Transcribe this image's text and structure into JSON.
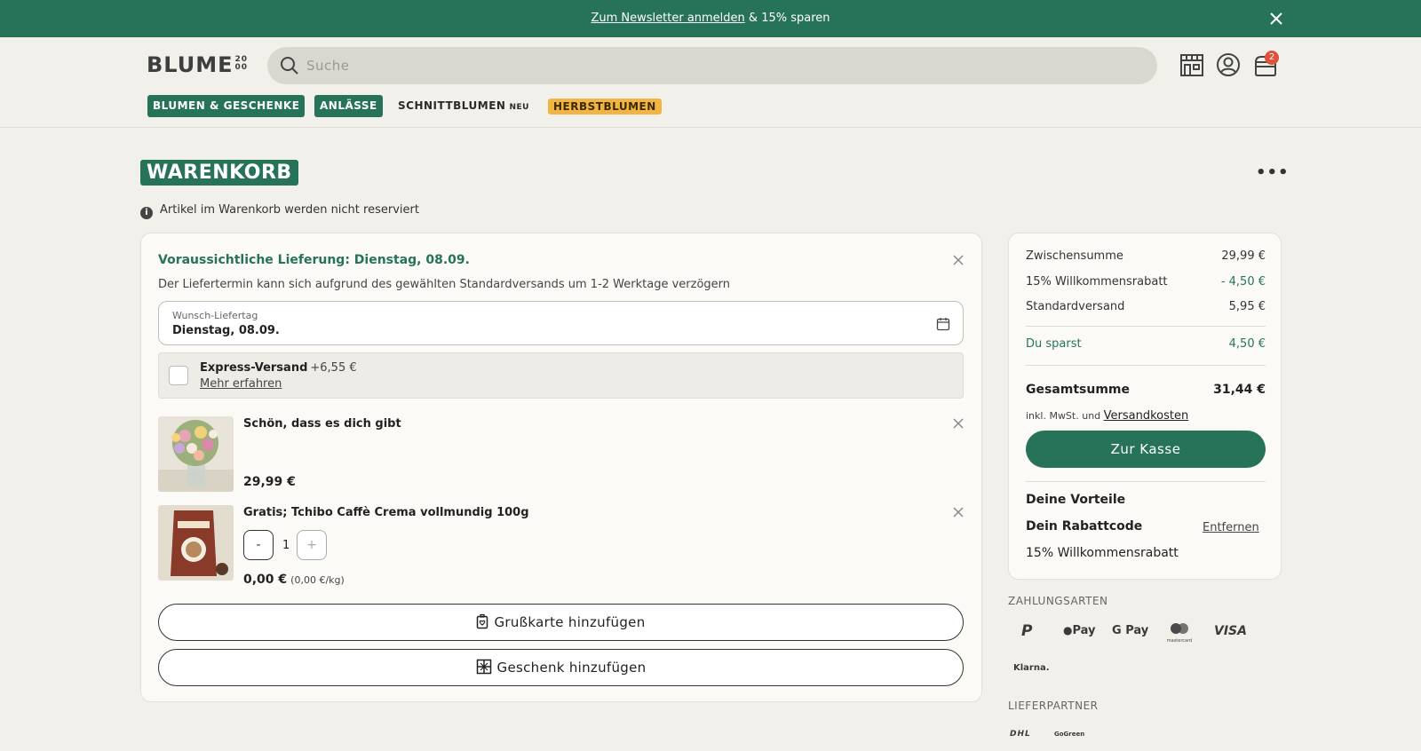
{
  "banner": {
    "link_text": "Zum Newsletter anmelden",
    "rest_text": " & 15% sparen"
  },
  "header": {
    "logo": "BLUME",
    "logo_num_top": "20",
    "logo_num_bottom": "00",
    "search_placeholder": "Suche",
    "cart_count": "2"
  },
  "nav": {
    "items": [
      {
        "label": "BLUMEN & GESCHENKE"
      },
      {
        "label": "ANLÄSSE"
      },
      {
        "label": "SCHNITTBLUMEN",
        "badge": "NEU"
      },
      {
        "label": "HERBSTBLUMEN"
      }
    ]
  },
  "page": {
    "title": "WARENKORB",
    "more": "•••",
    "info": "Artikel im Warenkorb werden nicht reserviert"
  },
  "delivery": {
    "title": "Voraussichtliche Lieferung: Dienstag, 08.09.",
    "note": "Der Liefertermin kann sich aufgrund des gewählten Standardversands um 1-2 Werktage verzögern",
    "date_label": "Wunsch-Liefertag",
    "date_value": "Dienstag, 08.09.",
    "express_name": "Express-Versand",
    "express_price": "+6,55 €",
    "express_link": "Mehr erfahren"
  },
  "items": [
    {
      "name": "Schön, dass es dich gibt",
      "price": "29,99 €"
    },
    {
      "name": "Gratis; Tchibo Caffè Crema vollmundig 100g",
      "price": "0,00 €",
      "unit_price": "(0,00 €/kg)",
      "qty": "1",
      "minus": "-",
      "plus": "+"
    }
  ],
  "actions": {
    "greeting_card": "Grußkarte hinzufügen",
    "gift": "Geschenk hinzufügen"
  },
  "summary": {
    "subtotal_label": "Zwischensumme",
    "subtotal_value": "29,99 €",
    "discount_label": "15% Willkommensrabatt",
    "discount_value": "- 4,50 €",
    "shipping_label": "Standardversand",
    "shipping_value": "5,95 €",
    "savings_label": "Du sparst",
    "savings_value": "4,50 €",
    "total_label": "Gesamtsumme",
    "total_value": "31,44 €",
    "vat_text": "inkl. MwSt. und",
    "vat_link": "Versandkosten",
    "checkout": "Zur Kasse",
    "benefits_title": "Deine Vorteile",
    "code_label": "Dein Rabattcode",
    "remove": "Entfernen",
    "code_value": "15% Willkommensrabatt"
  },
  "payment": {
    "title": "ZAHLUNGSARTEN",
    "methods": [
      "P",
      "Pay",
      "G Pay",
      "mastercard",
      "VISA",
      "Klarna."
    ]
  },
  "partners": {
    "title": "LIEFERPARTNER",
    "items": [
      "DHL",
      "GoGreen"
    ]
  },
  "colors": {
    "brand_green": "#27735a",
    "accent_orange": "#f2b544",
    "badge_red": "#e0513c",
    "background": "#f1f0eb"
  }
}
